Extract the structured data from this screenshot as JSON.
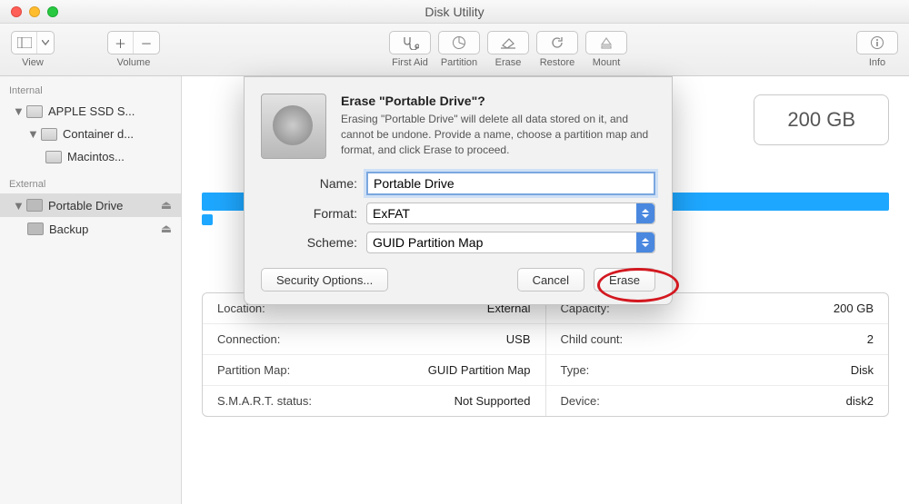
{
  "window_title": "Disk Utility",
  "toolbar": {
    "view_label": "View",
    "volume_label": "Volume",
    "first_aid": "First Aid",
    "partition": "Partition",
    "erase": "Erase",
    "restore": "Restore",
    "mount": "Mount",
    "info": "Info"
  },
  "sidebar": {
    "internal_header": "Internal",
    "external_header": "External",
    "internal": [
      {
        "label": "APPLE SSD S..."
      },
      {
        "label": "Container d..."
      },
      {
        "label": "Macintos..."
      }
    ],
    "external": [
      {
        "label": "Portable Drive"
      },
      {
        "label": "Backup"
      }
    ]
  },
  "main": {
    "capacity": "200 GB",
    "info": {
      "location_label": "Location:",
      "location_value": "External",
      "connection_label": "Connection:",
      "connection_value": "USB",
      "partition_map_label": "Partition Map:",
      "partition_map_value": "GUID Partition Map",
      "smart_label": "S.M.A.R.T. status:",
      "smart_value": "Not Supported",
      "capacity_label": "Capacity:",
      "capacity_value": "200 GB",
      "child_label": "Child count:",
      "child_value": "2",
      "type_label": "Type:",
      "type_value": "Disk",
      "device_label": "Device:",
      "device_value": "disk2"
    }
  },
  "modal": {
    "title": "Erase \"Portable Drive\"?",
    "description": "Erasing \"Portable Drive\" will delete all data stored on it, and cannot be undone. Provide a name, choose a partition map and format, and click Erase to proceed.",
    "name_label": "Name:",
    "name_value": "Portable Drive",
    "format_label": "Format:",
    "format_value": "ExFAT",
    "scheme_label": "Scheme:",
    "scheme_value": "GUID Partition Map",
    "security_options": "Security Options...",
    "cancel": "Cancel",
    "erase": "Erase"
  }
}
